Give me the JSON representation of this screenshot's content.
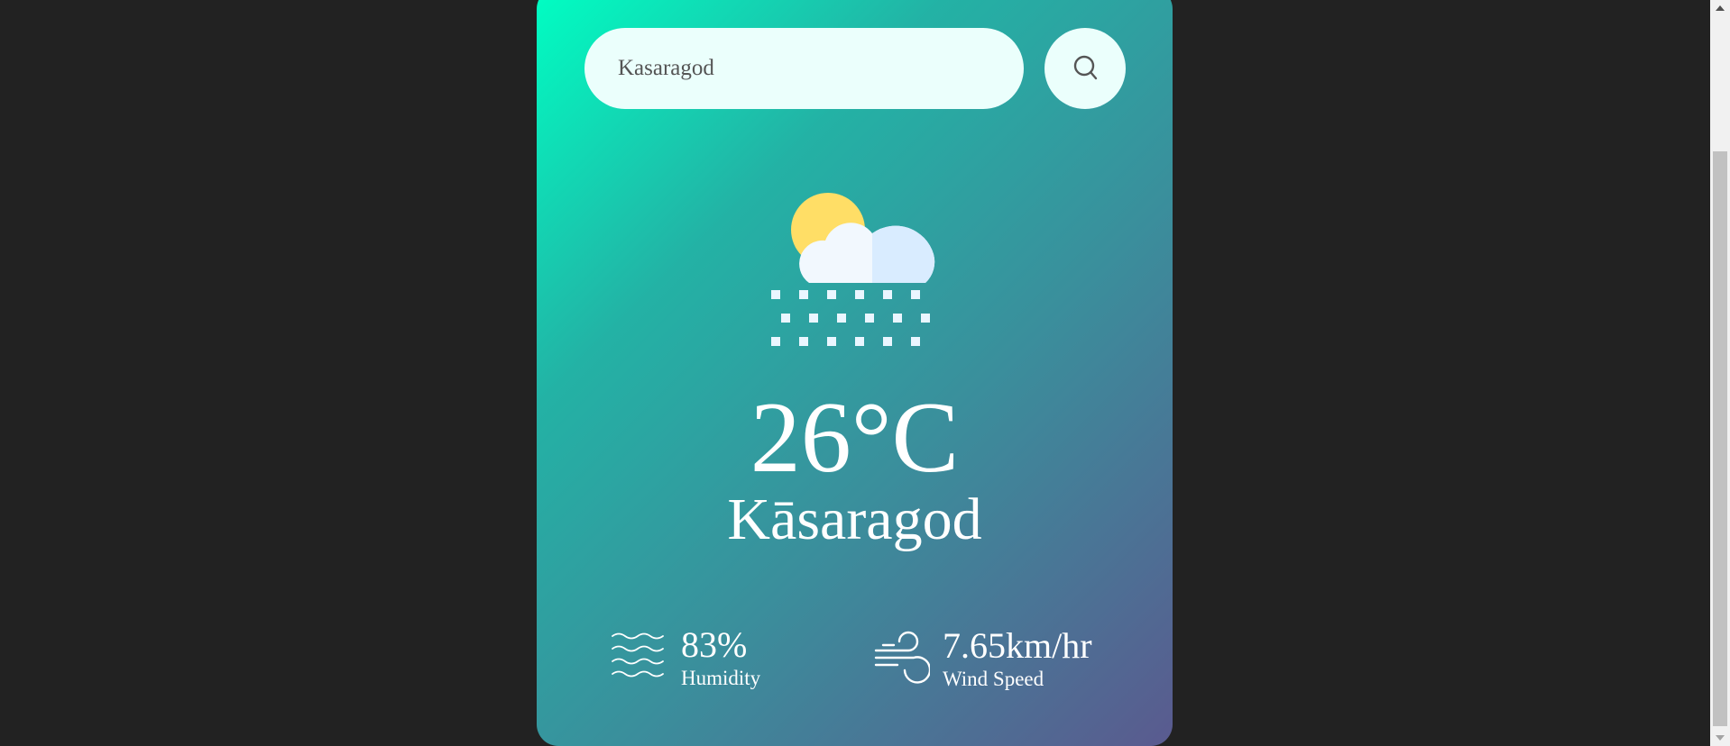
{
  "search": {
    "value": "Kasaragod",
    "placeholder": "",
    "button_icon": "search-icon"
  },
  "weather": {
    "icon": "cloud-snow-sun-icon",
    "temperature": "26°C",
    "city": "Kāsaragod"
  },
  "details": {
    "humidity": {
      "icon": "humidity-waves-icon",
      "value": "83%",
      "label": "Humidity"
    },
    "wind": {
      "icon": "wind-icon",
      "value": "7.65km/hr",
      "label": "Wind Speed"
    }
  },
  "colors": {
    "page_background": "#222222",
    "card_gradient_start": "#00ffc3",
    "card_gradient_end": "#5a5a8f",
    "input_background": "#ebfffc",
    "text": "#ffffff"
  }
}
